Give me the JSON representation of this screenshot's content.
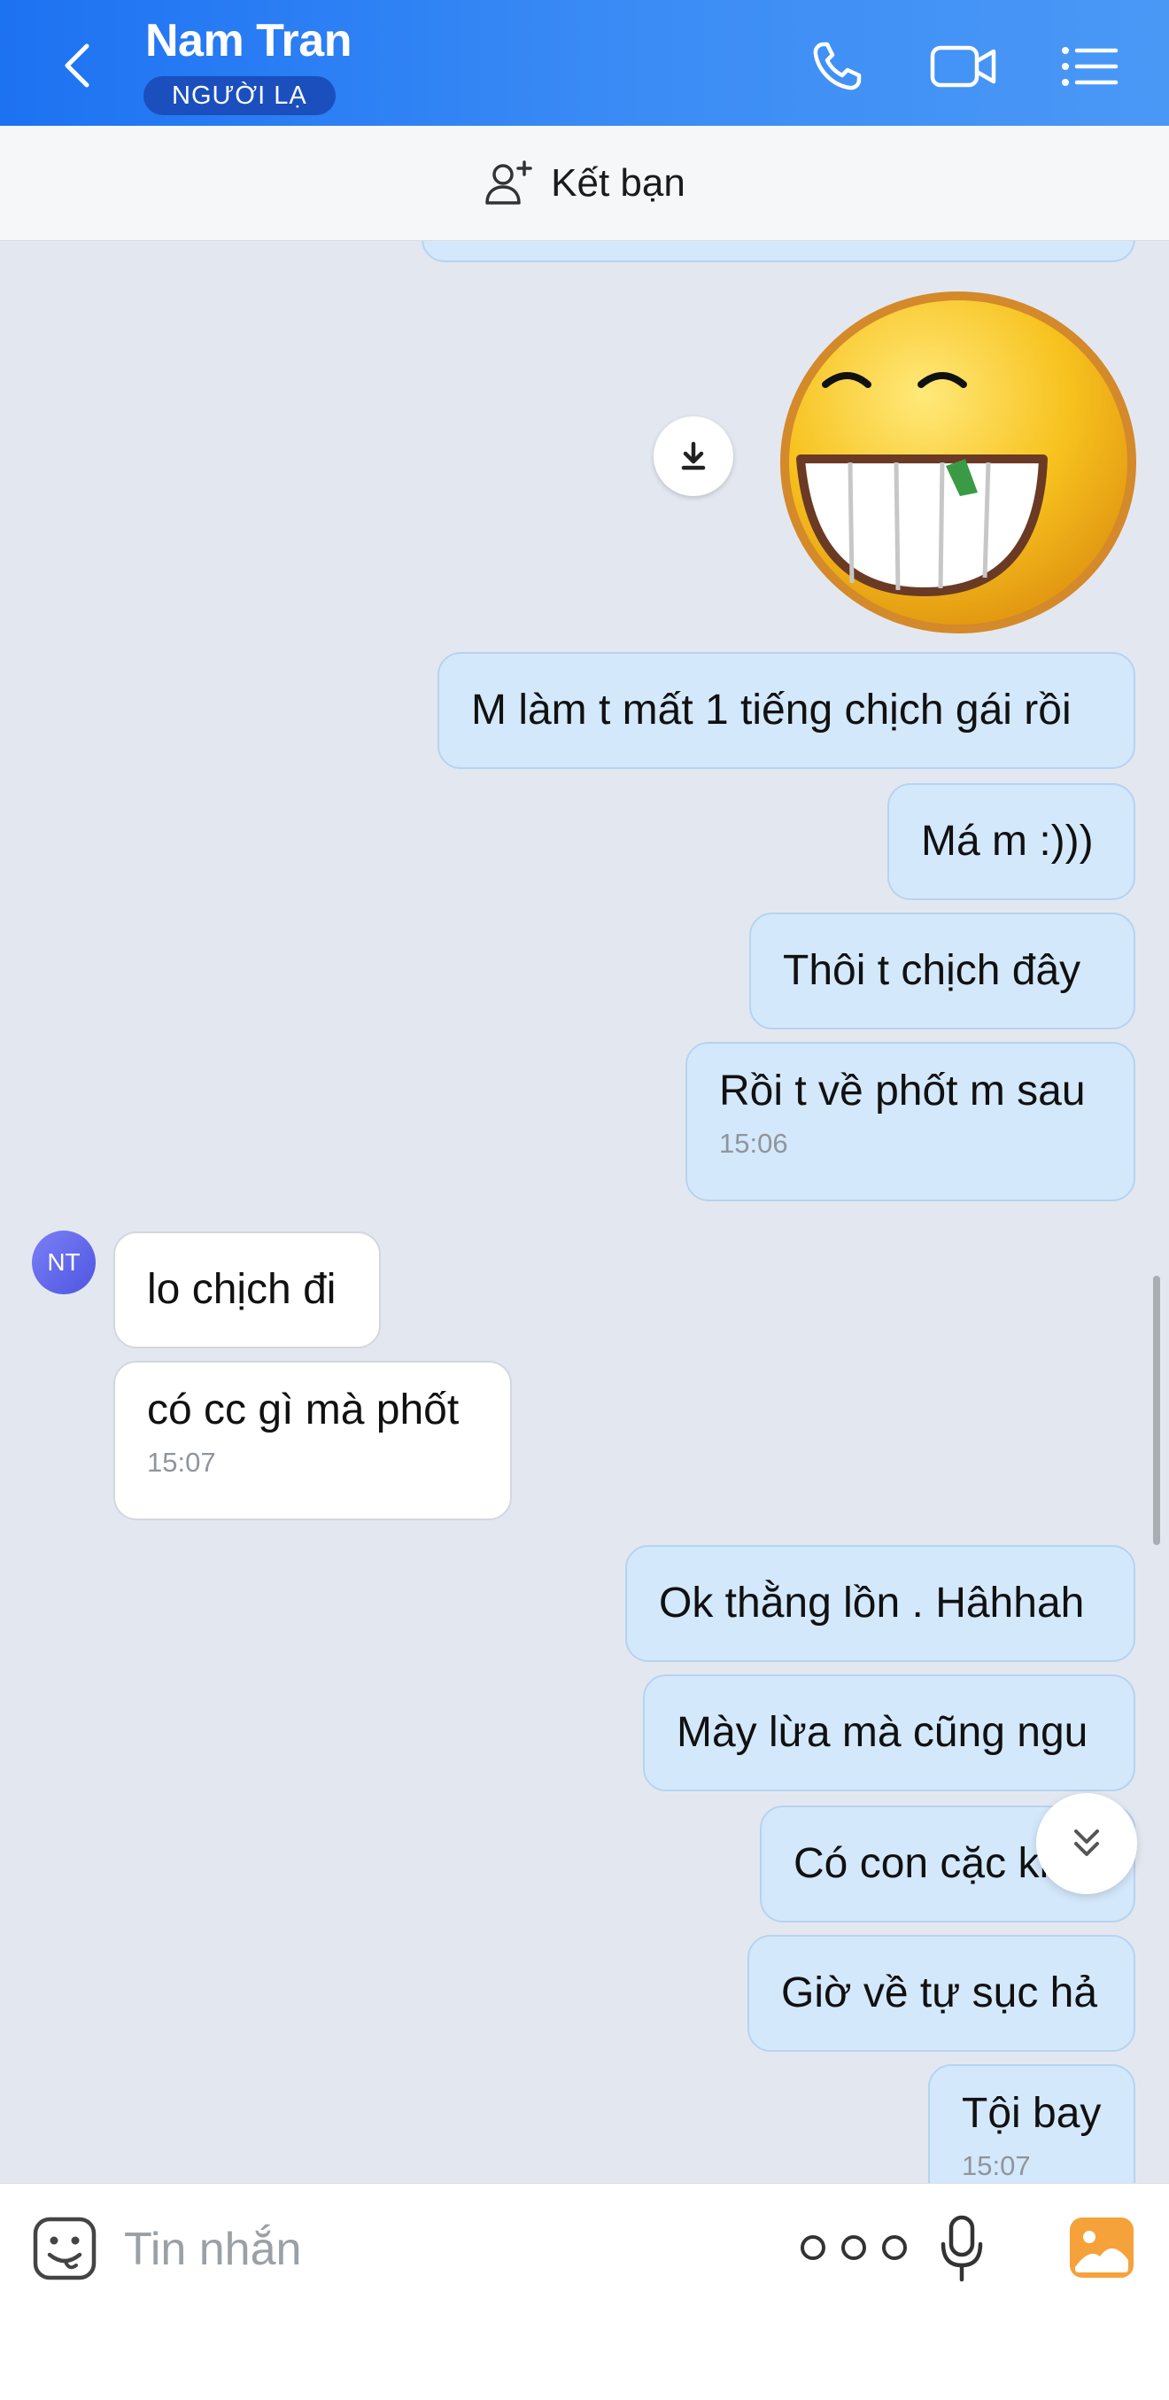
{
  "header": {
    "contact_name": "Nam Tran",
    "badge": "NGƯỜI LẠ",
    "icons": [
      "back-icon",
      "phone-icon",
      "video-call-icon",
      "menu-list-icon"
    ]
  },
  "add_friend": {
    "label": "Kết bạn",
    "icon": "add-user-icon"
  },
  "contact_avatar_initials": "NT",
  "messages": [
    {
      "text": "M làm t mất 1 tiếng chịch gái rồi"
    },
    {
      "text": "Má m :)))"
    },
    {
      "text": "Thôi t chịch đây"
    },
    {
      "text": "Rồi t về phốt m sau",
      "time": "15:06"
    },
    {
      "text": "lo chịch đi"
    },
    {
      "text": "có cc gì mà phốt",
      "time": "15:07"
    },
    {
      "text": "Ok thằng lồn . Hâhhah"
    },
    {
      "text": "Mày lừa mà cũng ngu"
    },
    {
      "text": "Có con cặc khô"
    },
    {
      "text": "Giờ về tự sục hả"
    },
    {
      "text": "Tội bay",
      "time": "15:07"
    }
  ],
  "input": {
    "placeholder": "Tin nhắn"
  },
  "colors": {
    "header": "#1d72f2",
    "my_bubble": "#d4e8fb",
    "their_bubble": "#ffffff",
    "chat_bg": "#e3e8f0"
  }
}
